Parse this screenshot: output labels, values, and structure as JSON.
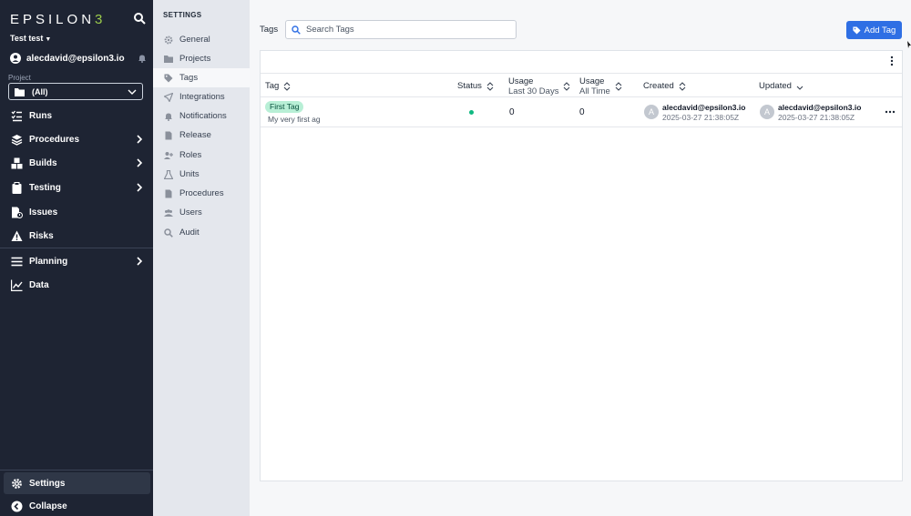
{
  "brand": {
    "logo_main": "EPSILON",
    "logo_accent": "3"
  },
  "org": {
    "name": "Test test"
  },
  "user": {
    "email": "alecdavid@epsilon3.io"
  },
  "project": {
    "label": "Project",
    "value": "(All)"
  },
  "nav": {
    "runs": "Runs",
    "procedures": "Procedures",
    "builds": "Builds",
    "testing": "Testing",
    "issues": "Issues",
    "risks": "Risks",
    "planning": "Planning",
    "data": "Data",
    "settings": "Settings",
    "collapse": "Collapse"
  },
  "settings_menu": {
    "title": "SETTINGS",
    "items": [
      "General",
      "Projects",
      "Tags",
      "Integrations",
      "Notifications",
      "Release",
      "Roles",
      "Units",
      "Procedures",
      "Users",
      "Audit"
    ],
    "active": "Tags"
  },
  "toolbar": {
    "tags_label": "Tags",
    "search_placeholder": "Search Tags",
    "add_label": "Add Tag"
  },
  "table": {
    "headers": {
      "tag": "Tag",
      "status": "Status",
      "usage30_title": "Usage",
      "usage30_sub": "Last 30 Days",
      "usage_all_title": "Usage",
      "usage_all_sub": "All Time",
      "created": "Created",
      "updated": "Updated"
    },
    "rows": [
      {
        "tag": "First Tag",
        "description": "My very first ag",
        "status": "active",
        "usage_30": "0",
        "usage_all": "0",
        "created_by": "alecdavid@epsilon3.io",
        "created_avatar": "A",
        "created_at": "2025-03-27 21:38:05Z",
        "updated_by": "alecdavid@epsilon3.io",
        "updated_avatar": "A",
        "updated_at": "2025-03-27 21:38:05Z"
      }
    ]
  },
  "colors": {
    "nav_bg": "#1e2433",
    "accent_blue": "#2f6fe4",
    "tag_green": "#b8efd6",
    "status_green": "#10b981",
    "logo_accent": "#9ccc4c"
  }
}
